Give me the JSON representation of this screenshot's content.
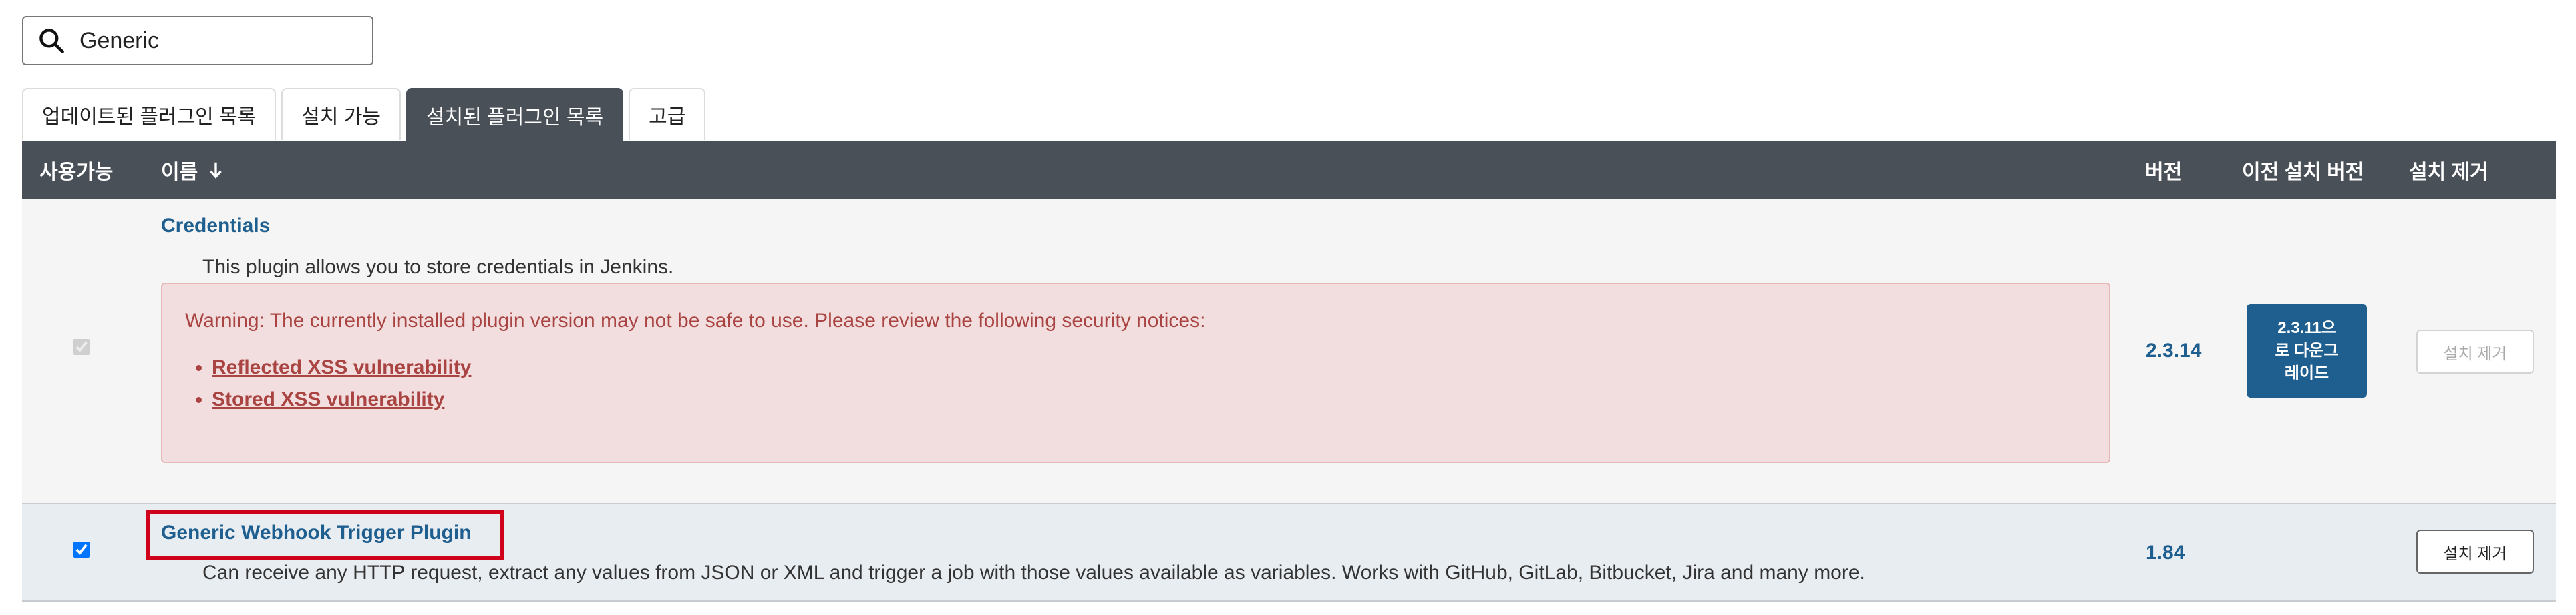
{
  "search": {
    "value": "Generic",
    "placeholder": "",
    "icon": "search-icon"
  },
  "tabs": [
    {
      "label": "업데이트된 플러그인 목록",
      "active": false
    },
    {
      "label": "설치 가능",
      "active": false
    },
    {
      "label": "설치된 플러그인 목록",
      "active": true
    },
    {
      "label": "고급",
      "active": false
    }
  ],
  "table": {
    "headers": {
      "enabled": "사용가능",
      "name": "이름",
      "name_sort_icon": "arrow-down-icon",
      "version": "버전",
      "previous_version": "이전 설치 버전",
      "uninstall": "설치 제거"
    },
    "rows": [
      {
        "name": "Credentials",
        "description": "This plugin allows you to store credentials in Jenkins.",
        "enabled": true,
        "enabled_disabled": true,
        "warning": {
          "text": "Warning: The currently installed plugin version may not be safe to use. Please review the following security notices:",
          "links": [
            "Reflected XSS vulnerability",
            "Stored XSS vulnerability"
          ]
        },
        "version": "2.3.14",
        "downgrade_label": "2.3.11으\n로 다운그\n레이드",
        "uninstall_label": "설치 제거",
        "uninstall_enabled": false
      },
      {
        "name": "Generic Webhook Trigger Plugin",
        "description": "Can receive any HTTP request, extract any values from JSON or XML and trigger a job with those values available as variables. Works with GitHub, GitLab, Bitbucket, Jira and many more.",
        "enabled": true,
        "version": "1.84",
        "uninstall_label": "설치 제거",
        "uninstall_enabled": true,
        "highlighted": true
      }
    ]
  },
  "colors": {
    "header_bg": "#4a5058",
    "link": "#1f5f8f",
    "warning_bg": "#f2dede",
    "warning_text": "#a94442",
    "highlight": "#d0021b"
  }
}
